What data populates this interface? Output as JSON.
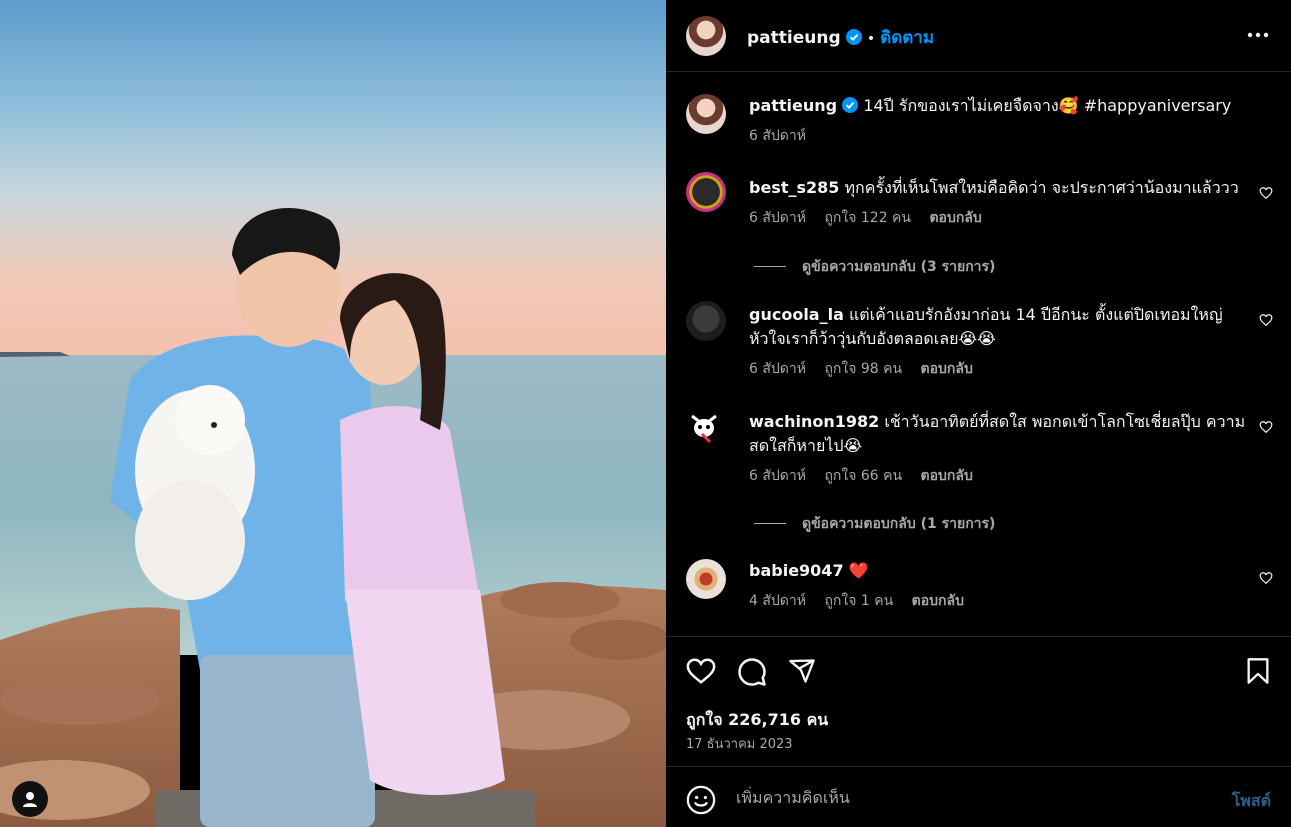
{
  "post": {
    "author": "pattieung",
    "follow_label": "ติดตาม",
    "dot": "•",
    "caption_text": "14ปี รักของเราไม่เคยจืดจาง🥰 #happyaniversary",
    "caption_age": "6 สัปดาห์",
    "likes": "ถูกใจ 226,716 คน",
    "date": "17 ธันวาคม 2023"
  },
  "comments": [
    {
      "user": "best_s285",
      "text": "ทุกครั้งที่เห็นโพสใหม่คือคิดว่า จะประกาศว่าน้องมาแล้ววว",
      "age": "6 สัปดาห์",
      "likes": "ถูกใจ 122 คน",
      "reply": "ตอบกลับ",
      "view_replies": "ดูข้อความตอบกลับ (3 รายการ)"
    },
    {
      "user": "gucoola_la",
      "text": "แต่เค้าแอบรักอังมาก่อน 14 ปีอีกนะ ตั้งแต่ปิดเทอมใหญ่ หัวใจเราก็ว้าวุ่นกับอังตลอดเลย😭😭",
      "age": "6 สัปดาห์",
      "likes": "ถูกใจ 98 คน",
      "reply": "ตอบกลับ"
    },
    {
      "user": "wachinon1982",
      "text": "เช้าวันอาทิตย์ที่สดใส พอกดเข้าโลกโซเชี่ยลปุ๊บ ความสดใสก็หายไป😭",
      "age": "6 สัปดาห์",
      "likes": "ถูกใจ 66 คน",
      "reply": "ตอบกลับ",
      "view_replies": "ดูข้อความตอบกลับ (1 รายการ)"
    },
    {
      "user": "babie9047",
      "text": "❤️",
      "age": "4 สัปดาห์",
      "likes": "ถูกใจ 1 คน",
      "reply": "ตอบกลับ"
    }
  ],
  "composer": {
    "placeholder": "เพิ่มความคิดเห็น",
    "post_label": "โพสต์"
  },
  "colors": {
    "accent": "#0095f6",
    "verified": "#0095f6",
    "muted": "#a8a8a8",
    "background": "#000000"
  },
  "icons": [
    "more-icon",
    "heart-icon",
    "comment-icon",
    "share-icon",
    "save-icon",
    "emoji-icon",
    "user-tag-icon",
    "verified-icon"
  ]
}
